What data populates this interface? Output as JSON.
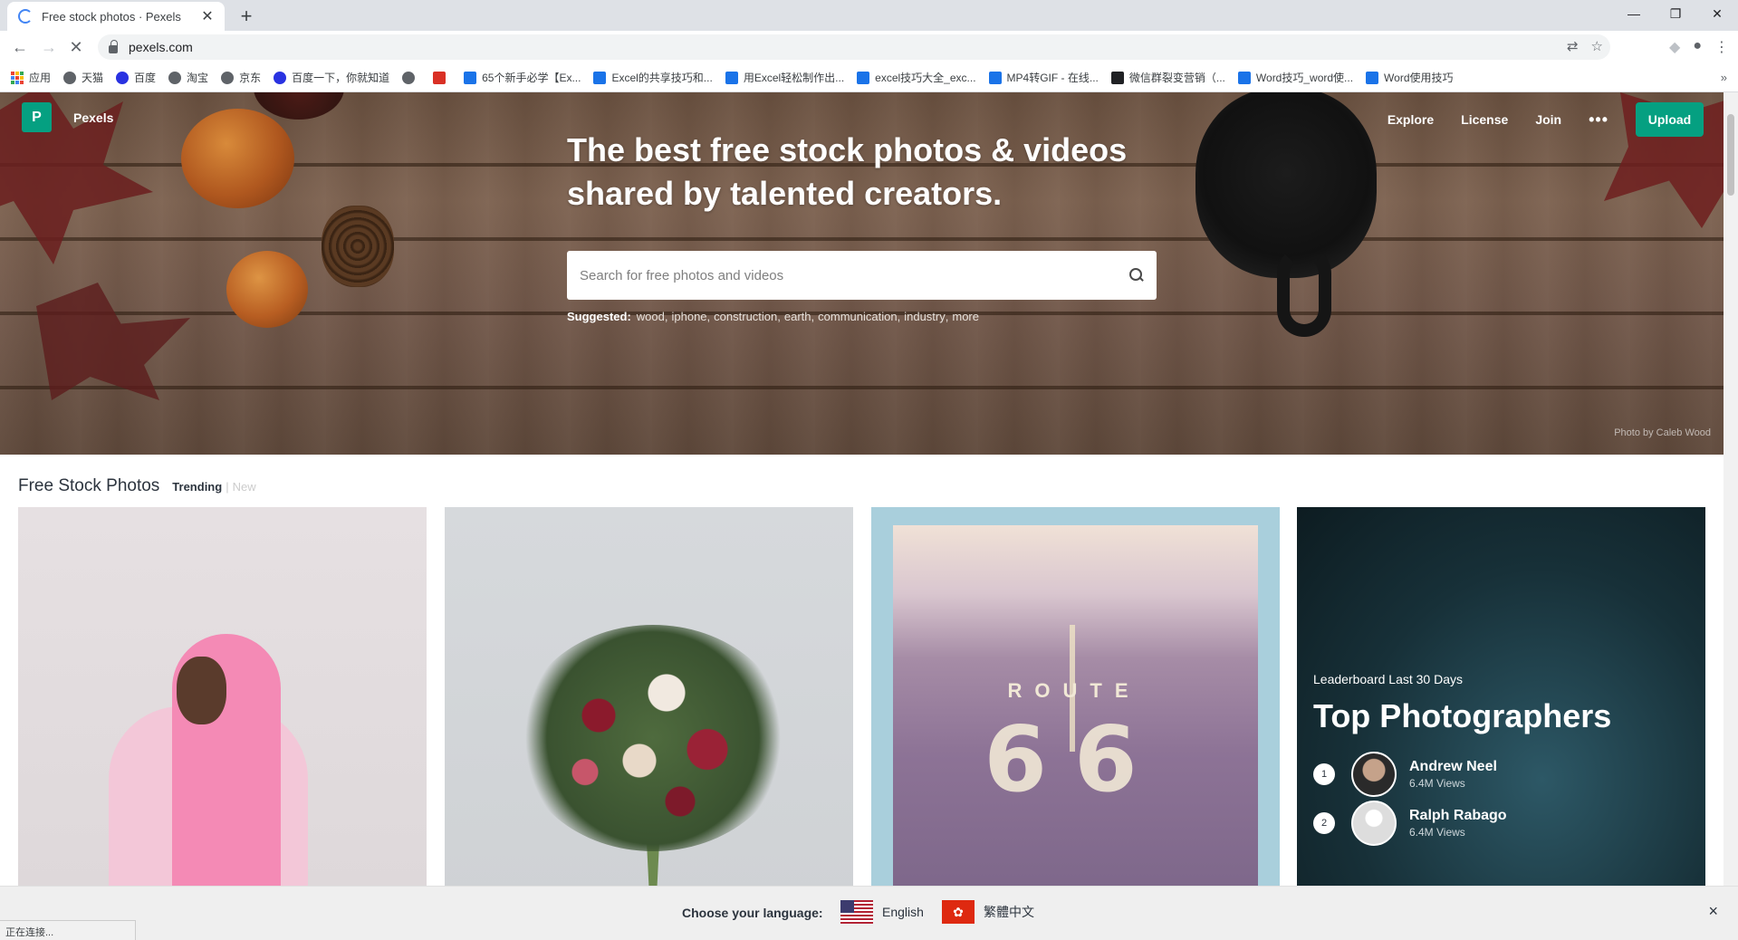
{
  "browser": {
    "tab_title": "Free stock photos · Pexels",
    "url": "pexels.com",
    "bookmarks": [
      {
        "label": "应用",
        "icon": "apps-icon"
      },
      {
        "label": "天猫",
        "icon": "globe-icon"
      },
      {
        "label": "百度",
        "icon": "baidu-icon"
      },
      {
        "label": "淘宝",
        "icon": "globe-icon"
      },
      {
        "label": "京东",
        "icon": "globe-icon"
      },
      {
        "label": "百度一下，你就知道",
        "icon": "baidu-icon"
      },
      {
        "label": "",
        "icon": "globe-icon"
      },
      {
        "label": "",
        "icon": "c-icon"
      },
      {
        "label": "65个新手必学【Ex...",
        "icon": "bookmark-icon"
      },
      {
        "label": "Excel的共享技巧和...",
        "icon": "bookmark-icon"
      },
      {
        "label": "用Excel轻松制作出...",
        "icon": "bookmark-icon"
      },
      {
        "label": "excel技巧大全_exc...",
        "icon": "bookmark-icon"
      },
      {
        "label": "MP4转GIF - 在线...",
        "icon": "bookmark-icon"
      },
      {
        "label": "微信群裂变营销（...",
        "icon": "m-icon"
      },
      {
        "label": "Word技巧_word使...",
        "icon": "bookmark-icon"
      },
      {
        "label": "Word使用技巧",
        "icon": "bookmark-icon"
      }
    ],
    "status": "正在连接..."
  },
  "header": {
    "logo_letter": "P",
    "brand": "Pexels",
    "nav": [
      "Explore",
      "License",
      "Join"
    ],
    "more": "•••",
    "upload": "Upload"
  },
  "hero": {
    "headline": "The best free stock photos & videos shared by talented creators.",
    "search_placeholder": "Search for free photos and videos",
    "suggested_label": "Suggested:",
    "suggested": [
      "wood",
      "iphone",
      "construction",
      "earth",
      "communication",
      "industry",
      "more"
    ],
    "credit": "Photo by Caleb Wood"
  },
  "section": {
    "title": "Free Stock Photos",
    "tab_trending": "Trending",
    "divider": "|",
    "tab_new": "New"
  },
  "photos": {
    "route_label": "ROUTE",
    "route_number": "66"
  },
  "leaderboard": {
    "subtitle": "Leaderboard Last 30 Days",
    "title": "Top Photographers",
    "entries": [
      {
        "rank": "1",
        "name": "Andrew Neel",
        "views": "6.4M Views"
      },
      {
        "rank": "2",
        "name": "Ralph Rabago",
        "views": "6.4M Views"
      }
    ]
  },
  "language_bar": {
    "label": "Choose your language:",
    "options": [
      "English",
      "繁體中文"
    ],
    "close": "×"
  },
  "colors": {
    "brand_green": "#05a081",
    "text_dark": "#2c343e"
  }
}
